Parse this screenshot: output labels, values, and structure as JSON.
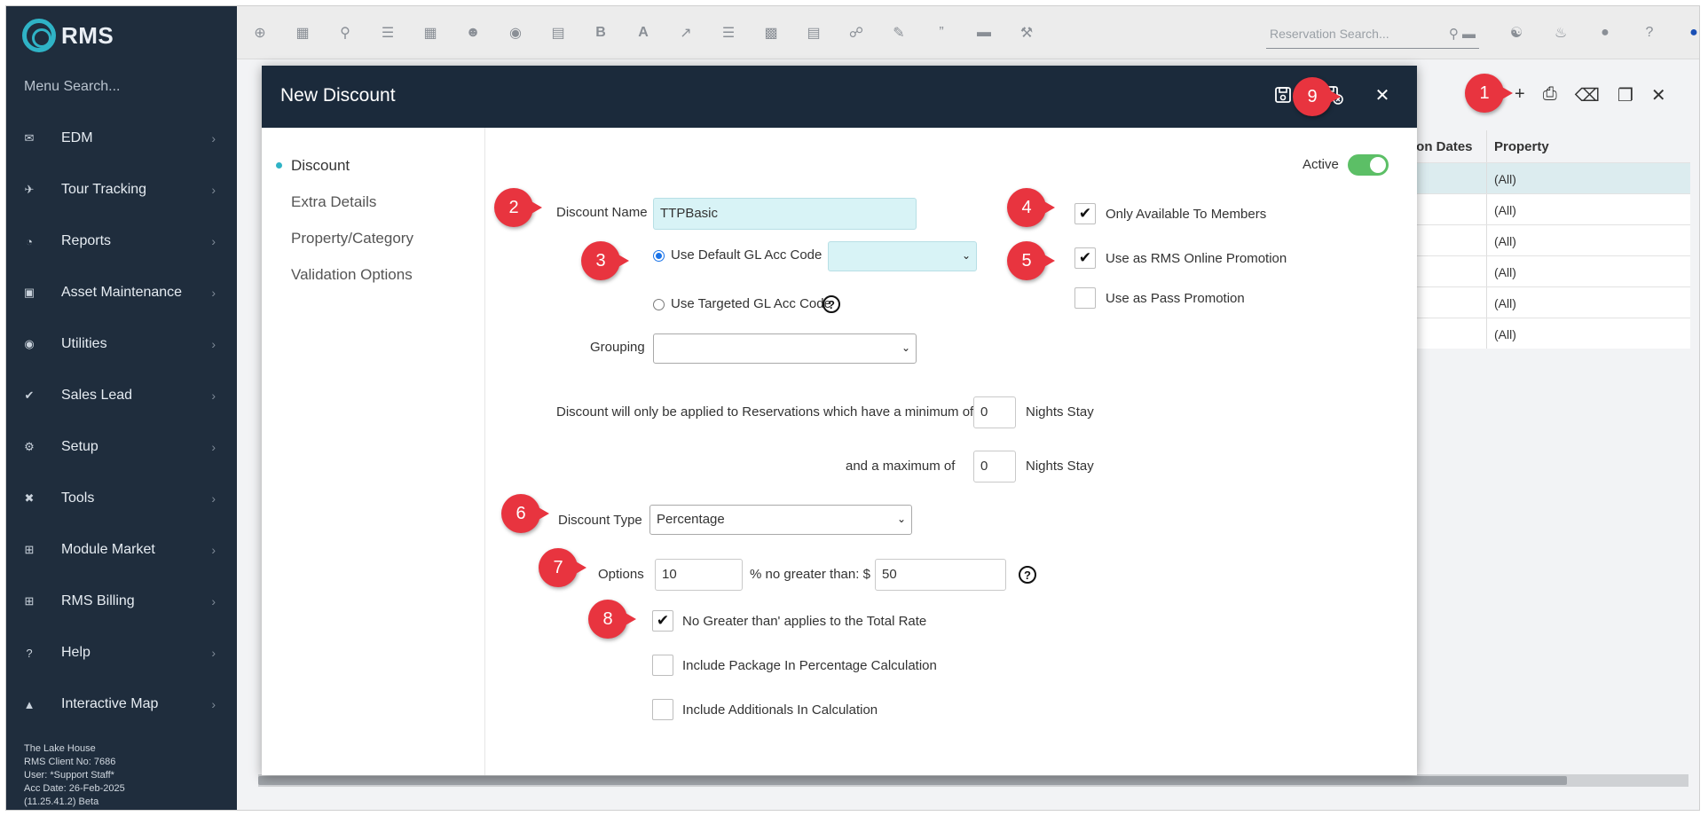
{
  "app": {
    "logo_text": "RMS"
  },
  "sidebar": {
    "menu_search": "Menu Search...",
    "items": [
      {
        "label": "EDM",
        "icon": "envelope-icon"
      },
      {
        "label": "Tour Tracking",
        "icon": "plane-icon"
      },
      {
        "label": "Reports",
        "icon": "pie-chart-icon"
      },
      {
        "label": "Asset Maintenance",
        "icon": "briefcase-icon"
      },
      {
        "label": "Utilities",
        "icon": "gauge-icon"
      },
      {
        "label": "Sales Lead",
        "icon": "check-circle-icon"
      },
      {
        "label": "Setup",
        "icon": "gear-icon"
      },
      {
        "label": "Tools",
        "icon": "tools-icon"
      },
      {
        "label": "Module Market",
        "icon": "plus-square-icon"
      },
      {
        "label": "RMS Billing",
        "icon": "plus-square-icon"
      },
      {
        "label": "Help",
        "icon": "question-circle-icon"
      },
      {
        "label": "Interactive Map",
        "icon": "map-icon"
      }
    ],
    "client_info": {
      "property": "The Lake House",
      "client_no": "RMS Client No: 7686",
      "user": "User: *Support Staff*",
      "acc_date": "Acc Date: 26-Feb-2025",
      "version": "(11.25.41.2)  Beta"
    }
  },
  "topbar": {
    "reservation_search_placeholder": "Reservation Search..."
  },
  "background_table": {
    "col1_header": "tion Dates",
    "col2_header": "Property",
    "rows": [
      "(All)",
      "(All)",
      "(All)",
      "(All)",
      "(All)",
      "(All)"
    ]
  },
  "modal": {
    "title": "New Discount",
    "nav": [
      {
        "label": "Discount"
      },
      {
        "label": "Extra Details"
      },
      {
        "label": "Property/Category"
      },
      {
        "label": "Validation Options"
      }
    ],
    "active_label": "Active",
    "active_on": true,
    "discount_name_label": "Discount Name",
    "discount_name_value": "TTPBasic",
    "use_default_gl_label": "Use Default GL Acc Code",
    "use_targeted_gl_label": "Use Targeted GL Acc Code",
    "grouping_label": "Grouping",
    "min_nights_text": "Discount will only be applied to Reservations which have a minimum of",
    "min_nights_value": "0",
    "nights_stay_label": "Nights Stay",
    "max_nights_text": "and a maximum of",
    "max_nights_value": "0",
    "discount_type_label": "Discount Type",
    "discount_type_value": "Percentage",
    "options_label": "Options",
    "options_percent_value": "10",
    "no_greater_than_label": "% no greater than: $",
    "no_greater_than_value": "50",
    "only_members_label": "Only Available To Members",
    "rms_online_label": "Use as RMS Online Promotion",
    "pass_promo_label": "Use as Pass Promotion",
    "total_rate_label": "No Greater than' applies to the Total Rate",
    "include_package_label": "Include Package In Percentage Calculation",
    "include_additionals_label": "Include Additionals In Calculation"
  },
  "callouts": [
    "1",
    "2",
    "3",
    "4",
    "5",
    "6",
    "7",
    "8",
    "9"
  ],
  "colors": {
    "sidebar_bg": "#1f2d3d",
    "modal_header_bg": "#1b2a3b",
    "accent": "#2fb3c6",
    "callout": "#e8343f",
    "toggle_on": "#5cbf66"
  }
}
